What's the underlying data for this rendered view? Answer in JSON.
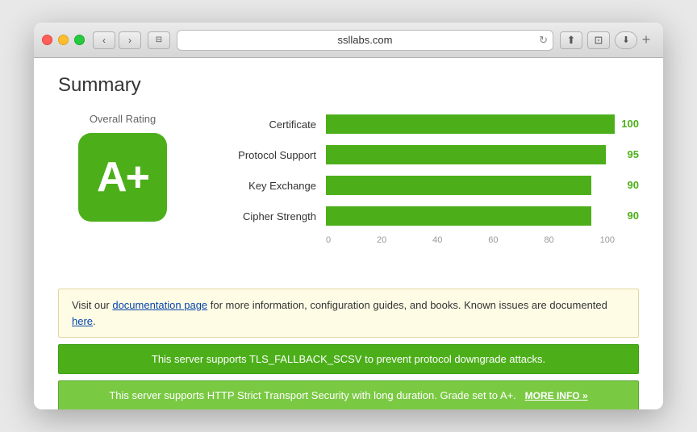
{
  "browser": {
    "url": "ssllabs.com",
    "traffic_lights": [
      "close",
      "minimize",
      "maximize"
    ],
    "nav_back": "‹",
    "nav_forward": "›",
    "reader_icon": "⊟",
    "refresh_icon": "↻",
    "share_icon": "⬆",
    "fullscreen_icon": "⊡",
    "download_icon": "⬇",
    "new_tab_icon": "+"
  },
  "page": {
    "title": "Summary",
    "overall_rating_label": "Overall Rating",
    "grade": "A+"
  },
  "chart": {
    "max_value": 100,
    "axis_labels": [
      "0",
      "20",
      "40",
      "60",
      "80",
      "100"
    ],
    "bars": [
      {
        "label": "Certificate",
        "value": 100,
        "percent": 100
      },
      {
        "label": "Protocol Support",
        "value": 95,
        "percent": 95
      },
      {
        "label": "Key Exchange",
        "value": 90,
        "percent": 90
      },
      {
        "label": "Cipher Strength",
        "value": 90,
        "percent": 90
      }
    ]
  },
  "banners": {
    "info": {
      "text_before_link1": "Visit our ",
      "link1_text": "documentation page",
      "text_after_link1": " for more information, configuration guides, and books. Known issues are documented ",
      "link2_text": "here",
      "text_after_link2": "."
    },
    "tls_fallback": "This server supports TLS_FALLBACK_SCSV to prevent protocol downgrade attacks.",
    "hsts": "This server supports HTTP Strict Transport Security with long duration. Grade set to A+.",
    "more_info_label": "MORE INFO »"
  },
  "colors": {
    "green_dark": "#4caf1a",
    "green_light": "#7ac943",
    "info_bg": "#fffce6",
    "link_color": "#0645ad"
  }
}
